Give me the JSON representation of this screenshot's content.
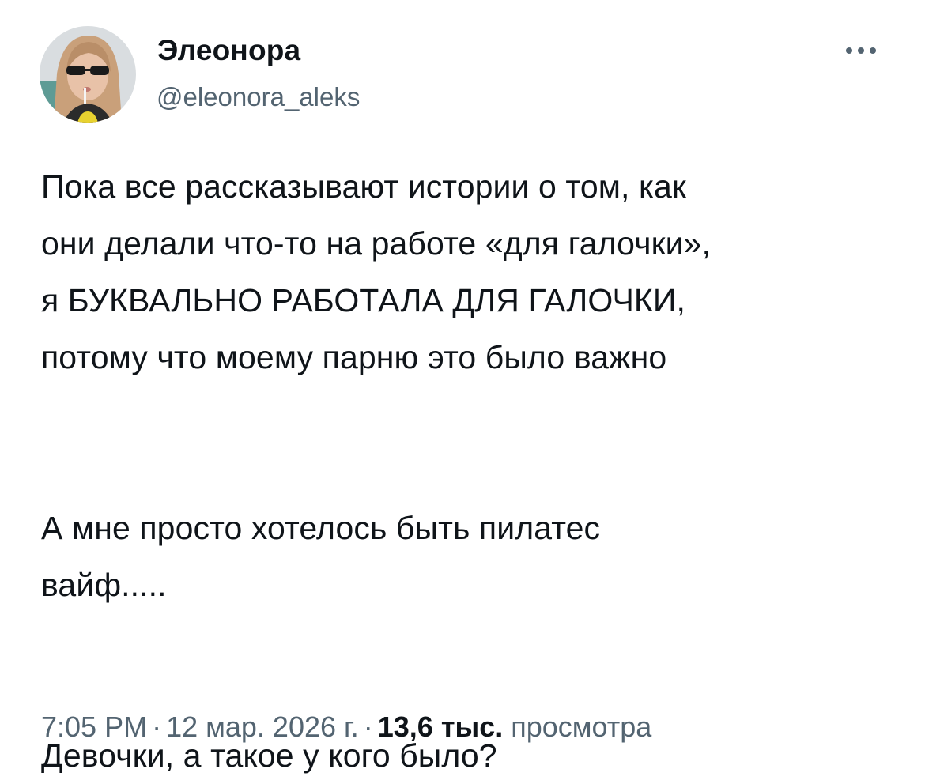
{
  "author": {
    "display_name": "Элеонора",
    "handle": "@eleonora_aleks",
    "avatar_icon": "avatar-photo"
  },
  "menu": {
    "more_icon": "more-horizontal-icon"
  },
  "tweet": {
    "paragraphs": [
      "Пока все рассказывают истории о том, как\nони делали что-то на работе «для галочки»,\nя БУКВАЛЬНО РАБОТАЛА ДЛЯ ГАЛОЧКИ,\nпотому что моему парню это было важно",
      "А мне просто хотелось быть пилатес\nвайф.....",
      "Девочки, а такое у кого было?"
    ]
  },
  "meta": {
    "time": "7:05 PM",
    "separator": "·",
    "date": "12 мар. 2026 г.",
    "views_count": "13,6 тыс.",
    "views_label": "просмотра"
  },
  "colors": {
    "text": "#0f1419",
    "secondary": "#536471",
    "background": "#ffffff"
  }
}
